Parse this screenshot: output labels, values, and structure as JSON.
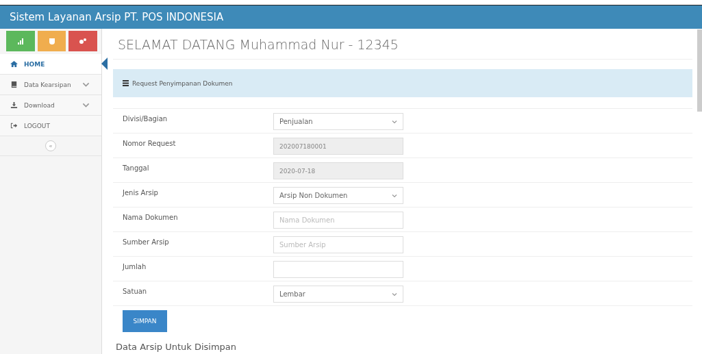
{
  "header": {
    "title": "Sistem Layanan Arsip PT. POS INDONESIA"
  },
  "sidebar": {
    "shortcuts": [
      {
        "color": "#5cb85c"
      },
      {
        "color": "#f0ad4e"
      },
      {
        "color": "#d9534f"
      }
    ],
    "items": [
      {
        "label": "HOME",
        "selected": true,
        "expandable": false
      },
      {
        "label": "Data Kearsipan",
        "selected": false,
        "expandable": true
      },
      {
        "label": "Download",
        "selected": false,
        "expandable": true
      },
      {
        "label": "LOGOUT",
        "selected": false,
        "expandable": false
      }
    ],
    "collapse": "«"
  },
  "page_title": "SELAMAT DATANG Muhammad Nur - 12345",
  "panel": {
    "title": "Request Penyimpanan Dokumen"
  },
  "form": [
    {
      "label": "Divisi/Bagian",
      "kind": "select",
      "value": "Penjualan"
    },
    {
      "label": "Nomor Request",
      "kind": "readonly",
      "value": "202007180001"
    },
    {
      "label": "Tanggal",
      "kind": "readonly",
      "value": "2020-07-18"
    },
    {
      "label": "Jenis Arsip",
      "kind": "select",
      "value": "Arsip Non Dokumen"
    },
    {
      "label": "Nama Dokumen",
      "kind": "text",
      "placeholder": "Nama Dokumen"
    },
    {
      "label": "Sumber Arsip",
      "kind": "text",
      "placeholder": "Sumber Arsip"
    },
    {
      "label": "Jumlah",
      "kind": "text"
    },
    {
      "label": "Satuan",
      "kind": "select",
      "value": "Lembar"
    }
  ],
  "submit": "SIMPAN",
  "section_title": "Data Arsip Untuk Disimpan"
}
